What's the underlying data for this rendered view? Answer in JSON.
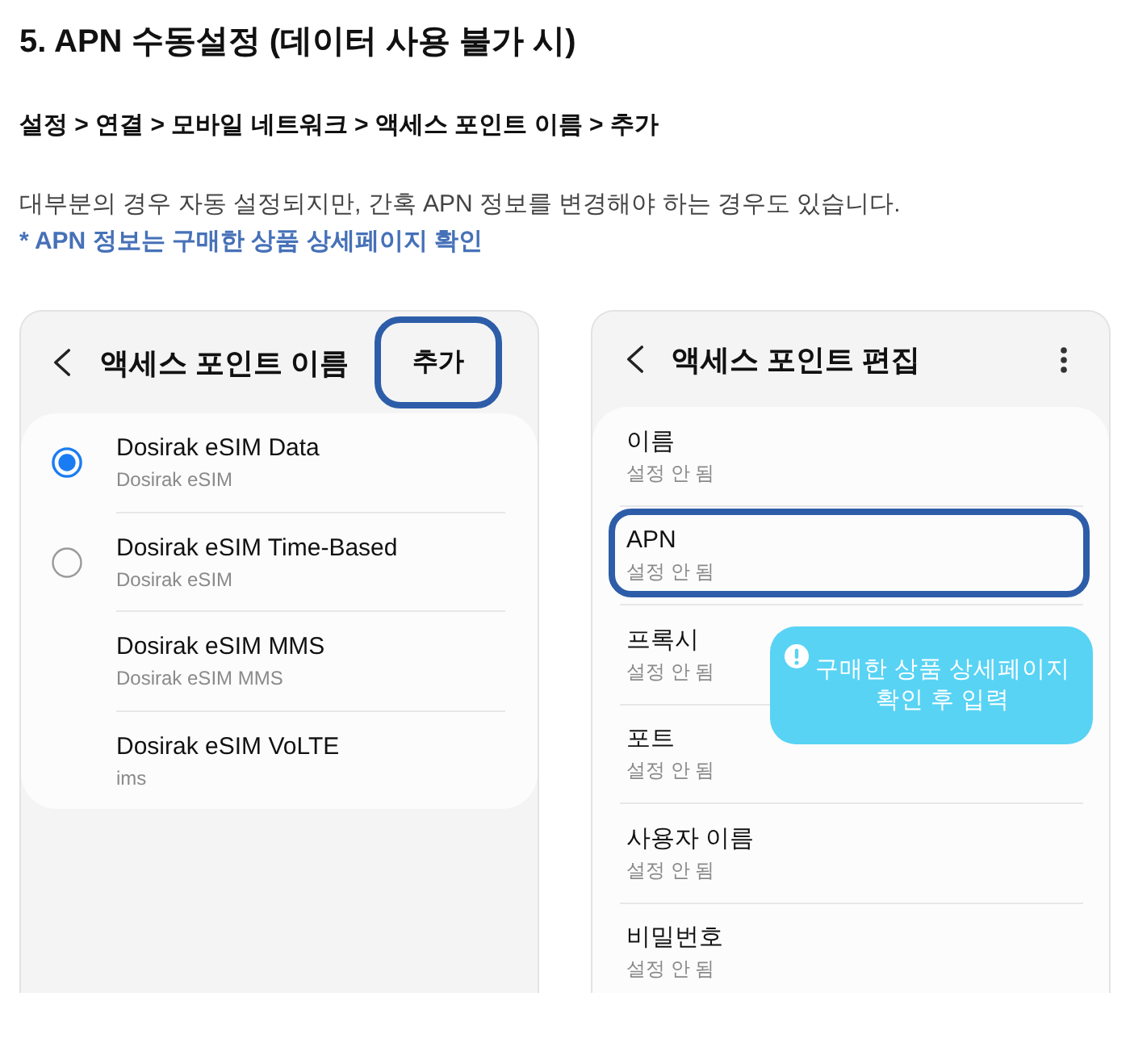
{
  "heading": "5. APN 수동설정 (데이터 사용 불가 시)",
  "breadcrumb": "설정 > 연결 > 모바일 네트워크 > 액세스 포인트 이름 > 추가",
  "description": "대부분의 경우 자동 설정되지만, 간혹 APN 정보를 변경해야 하는 경우도 있습니다.",
  "note": "* APN 정보는 구매한 상품 상세페이지 확인",
  "screens": [
    {
      "kind": "apn_list",
      "title": "액세스 포인트 이름",
      "action": {
        "label": "추가",
        "highlighted": true
      },
      "items": [
        {
          "kind": "radio",
          "name": "Dosirak eSIM Data",
          "type": "Dosirak eSIM",
          "selected": true
        },
        {
          "kind": "radio",
          "name": "Dosirak eSIM Time-Based",
          "type": "Dosirak eSIM",
          "selected": false
        },
        {
          "kind": "plain",
          "name": "Dosirak eSIM MMS",
          "type": "Dosirak eSIM MMS"
        },
        {
          "kind": "plain",
          "name": "Dosirak eSIM VoLTE",
          "type": "ims"
        }
      ]
    },
    {
      "kind": "apn_edit",
      "title": "액세스 포인트 편집",
      "fields": [
        {
          "label": "이름",
          "value": "설정 안 됨",
          "highlighted": false
        },
        {
          "label": "APN",
          "value": "설정 안 됨",
          "highlighted": true
        },
        {
          "label": "프록시",
          "value": "설정 안 됨",
          "highlighted": false
        },
        {
          "label": "포트",
          "value": "설정 안 됨",
          "highlighted": false
        },
        {
          "label": "사용자 이름",
          "value": "설정 안 됨",
          "highlighted": false
        },
        {
          "label": "비밀번호",
          "value": "설정 안 됨",
          "highlighted": false
        }
      ],
      "tooltip": {
        "text": "구매한 상품 상세페이지\n확인 후 입력"
      }
    }
  ]
}
